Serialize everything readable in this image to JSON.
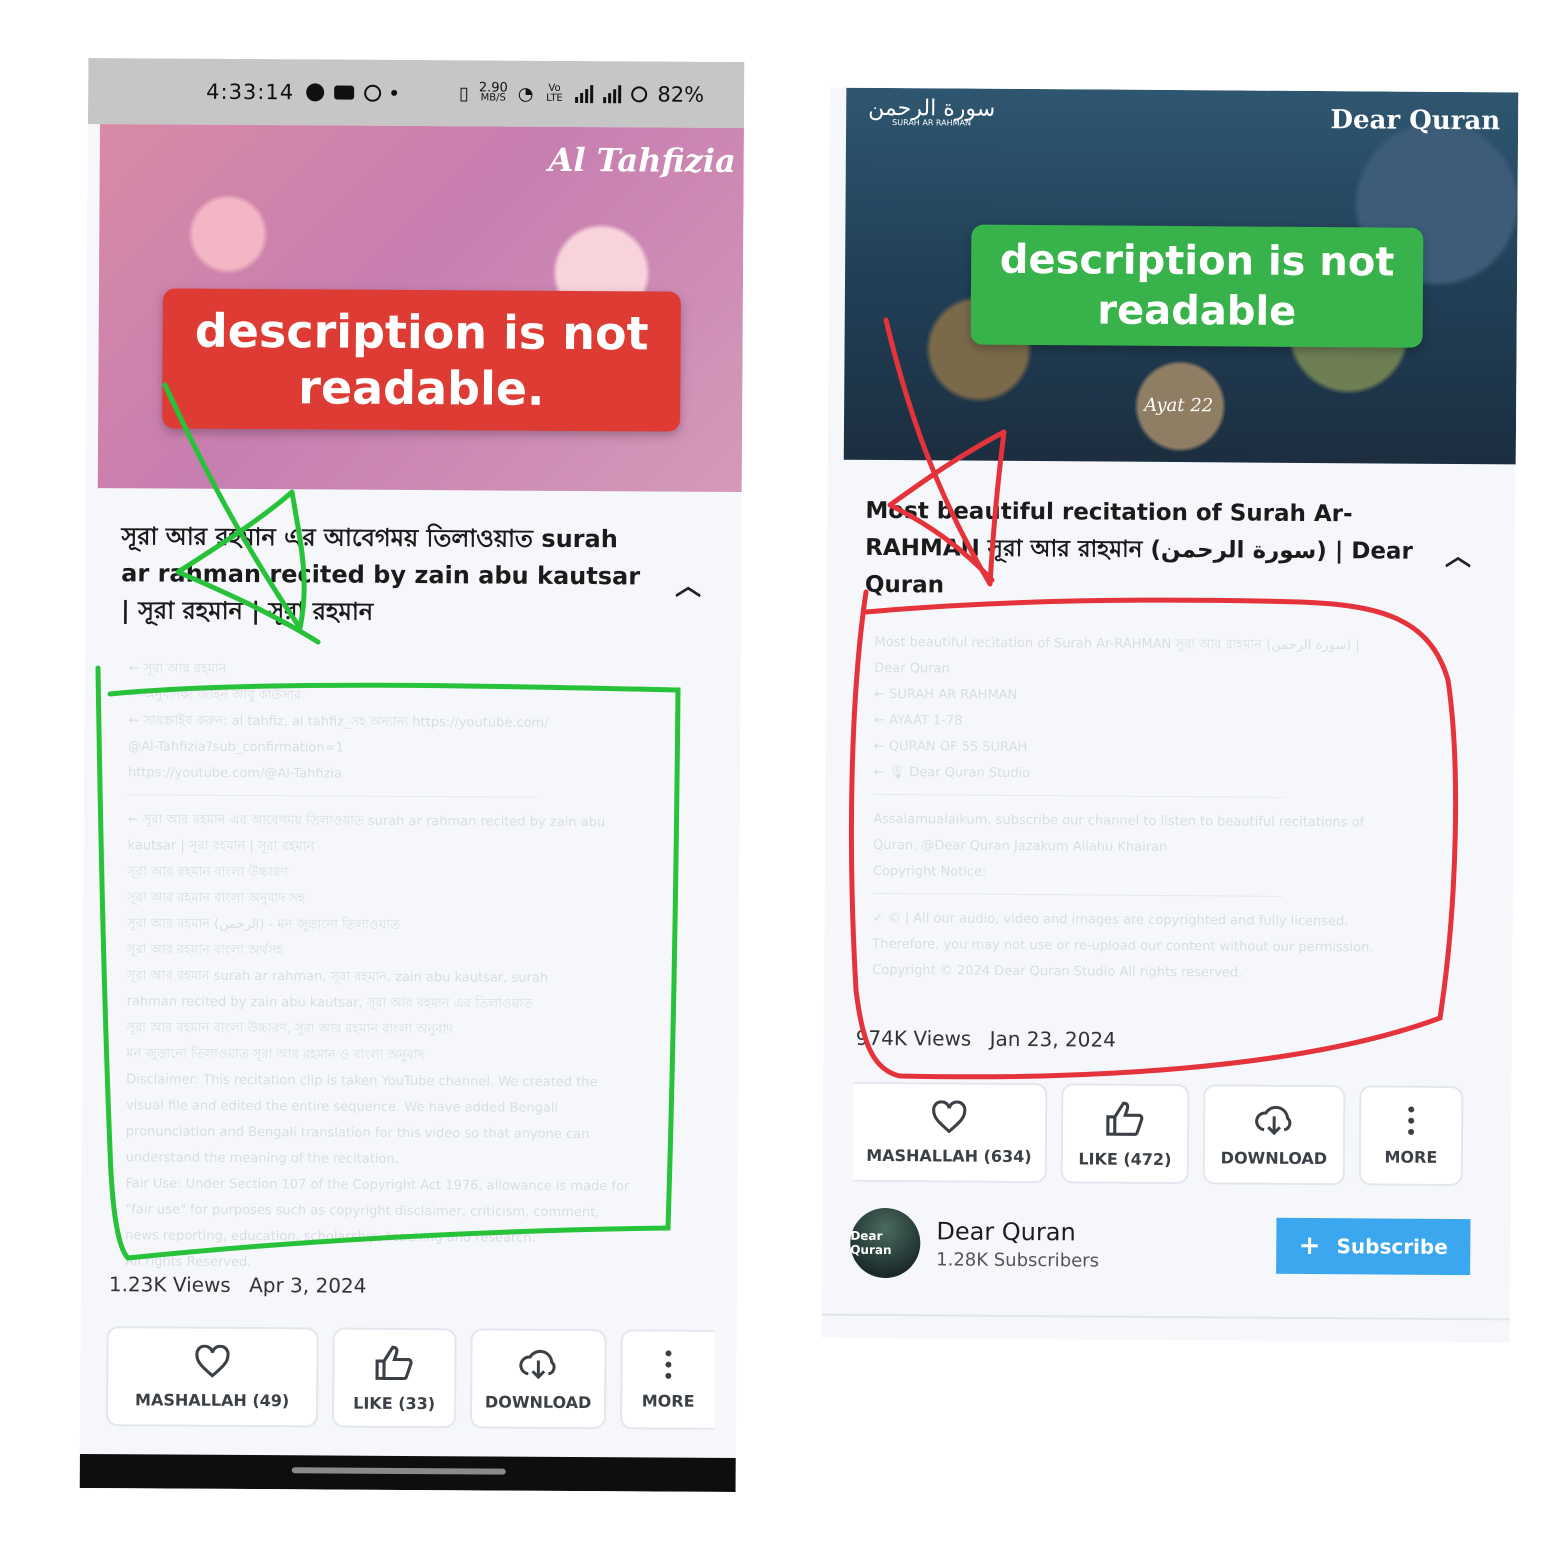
{
  "left": {
    "status": {
      "time": "4:33:14",
      "net_speed_top": "2.90",
      "net_speed_bottom": "MB/S",
      "lte": "Vo LTE",
      "battery": "82%"
    },
    "thumbnail": {
      "brand": "Al Tahfizia",
      "annotation": "description is not readable."
    },
    "title": "সূরা আর রহমান এর আবেগময় তিলাওয়াত  surah ar rahman recited by zain abu kautsar | সূরা রহমান | সূরা রহমান",
    "description_lines": [
      "← সূরা আর রহমান",
      "← অনুবাদক: জাইন আবু কাউসার",
      "← সাবস্ক্রাইব করুন: al tahfiz, al tahfiz_সহ অন্যান্য https://youtube.com/",
      "@Al-Tahfizia?sub_confirmation=1",
      "https://youtube.com/@Al-Tahfizia",
      "",
      "← সূরা আর রহমান এর আবেগময় তিলাওয়াত surah ar rahman recited by zain abu",
      "kautsar | সূরা রহমান | সূরা রহমান",
      "সূরা আর রহমান বাংলা উচ্চারণ",
      "সূরা আর রহমান বাংলা অনুবাদ সহ",
      "সূরা আর রহমান (الرحمن) - মন জুড়ানো তিলাওয়াত",
      "সূরা আর রহমান বাংলা অর্থসহ",
      "সূরা আর রহমান surah ar rahman, সূরা রহমান, zain abu kautsar, surah",
      "rahman recited by zain abu kautsar, সূরা আর রহমান এর তিলাওয়াত",
      "সূরা আর রহমান বাংলা উচ্চারণ, সূরা আর রহমান বাংলা অনুবাদ",
      "মন জুড়ানো তিলাওয়াত সূরা আর রহমান ও বাংলা অনুবাদ",
      "Disclaimer: This recitation clip is taken  YouTube channel. We created the",
      "visual file and edited the entire sequence. We have added Bengali",
      "pronunciation and Bengali translation for this video so that anyone can",
      "understand the meaning of the recitation.",
      "Fair Use: Under Section 107 of the Copyright Act 1976, allowance is made for",
      "\"fair use\" for purposes such as copyright disclaimer, criticism, comment,",
      "news reporting, education, scholarship, teaching and research.",
      "All rights Reserved."
    ],
    "views": "1.23K Views",
    "date": "Apr 3, 2024",
    "actions": {
      "mashallah": "MASHALLAH (49)",
      "like": "LIKE (33)",
      "download": "DOWNLOAD",
      "more": "MORE"
    }
  },
  "right": {
    "thumbnail": {
      "top_left_arabic": "سورة الرحمن",
      "top_left_caption": "SURAH AR RAHMAN",
      "brand": "Dear Quran",
      "ayat_label": "Ayat 22",
      "annotation": "description is not readable"
    },
    "title": "Most beautiful recitation of Surah Ar-RAHMAN সূরা আর রাহমান (سورة الرحمن) | Dear Quran",
    "description_lines": [
      "Most beautiful recitation of Surah Ar-RAHMAN সূরা আর রাহমান (سورة الرحمن) |",
      "Dear Quran",
      "← SURAH AR RAHMAN",
      "← AYAAT 1-78",
      "← QURAN OF 55 SURAH",
      "← 🎙 Dear Quran Studio",
      "",
      "Assalamualaikum, subscribe our channel to listen to beautiful recitations of",
      "Quran. @Dear Quran Jazakum Allahu Khairan",
      "Copyright Notice:",
      "",
      "✓ © | All our audio, video and images are copyrighted and fully licensed.",
      "Therefore, you may not use or re-upload our content without our permission.",
      "Copyright © 2024 Dear Quran Studio All rights reserved."
    ],
    "views": "974K Views",
    "date": "Jan 23, 2024",
    "actions": {
      "mashallah": "MASHALLAH (634)",
      "like": "LIKE (472)",
      "download": "DOWNLOAD",
      "more": "MORE"
    },
    "channel": {
      "avatar_text": "Dear Quran",
      "name": "Dear Quran",
      "subscribers": "1.28K Subscribers",
      "subscribe_label": "Subscribe",
      "subscribe_icon": "+"
    }
  },
  "colors": {
    "red_annotation": "#dd3b34",
    "green_annotation": "#38b24a",
    "subscribe_blue": "#3aa7ee",
    "green_ink": "#27c23a",
    "red_ink": "#e5333b"
  }
}
